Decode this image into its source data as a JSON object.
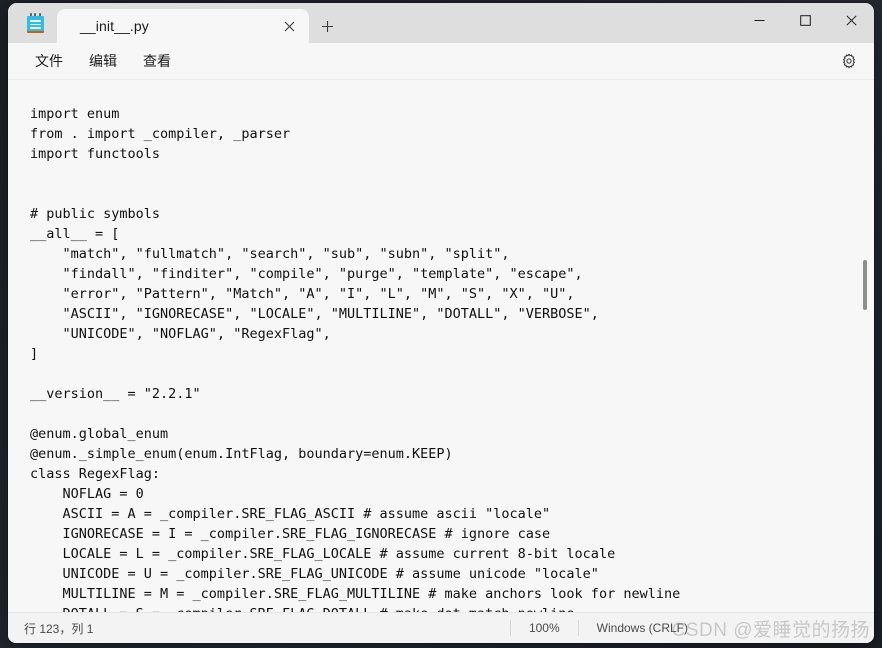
{
  "window": {
    "app_icon": "notepad-icon",
    "minimize_label": "最小化",
    "maximize_label": "最大化",
    "close_label": "关闭"
  },
  "tabs": [
    {
      "title": "__init__.py",
      "close_label": "×"
    }
  ],
  "new_tab_label": "+",
  "menubar": {
    "items": [
      {
        "label": "文件"
      },
      {
        "label": "编辑"
      },
      {
        "label": "查看"
      }
    ],
    "settings_label": "设置"
  },
  "editor": {
    "content": "import enum\nfrom . import _compiler, _parser\nimport functools\n\n\n# public symbols\n__all__ = [\n    \"match\", \"fullmatch\", \"search\", \"sub\", \"subn\", \"split\",\n    \"findall\", \"finditer\", \"compile\", \"purge\", \"template\", \"escape\",\n    \"error\", \"Pattern\", \"Match\", \"A\", \"I\", \"L\", \"M\", \"S\", \"X\", \"U\",\n    \"ASCII\", \"IGNORECASE\", \"LOCALE\", \"MULTILINE\", \"DOTALL\", \"VERBOSE\",\n    \"UNICODE\", \"NOFLAG\", \"RegexFlag\",\n]\n\n__version__ = \"2.2.1\"\n\n@enum.global_enum\n@enum._simple_enum(enum.IntFlag, boundary=enum.KEEP)\nclass RegexFlag:\n    NOFLAG = 0\n    ASCII = A = _compiler.SRE_FLAG_ASCII # assume ascii \"locale\"\n    IGNORECASE = I = _compiler.SRE_FLAG_IGNORECASE # ignore case\n    LOCALE = L = _compiler.SRE_FLAG_LOCALE # assume current 8-bit locale\n    UNICODE = U = _compiler.SRE_FLAG_UNICODE # assume unicode \"locale\"\n    MULTILINE = M = _compiler.SRE_FLAG_MULTILINE # make anchors look for newline\n    DOTALL = S = _compiler.SRE_FLAG_DOTALL # make dot match newline"
  },
  "statusbar": {
    "position": "行 123，列 1",
    "zoom": "100%",
    "line_ending": "Windows (CRLF)"
  },
  "watermark": {
    "text": "CSDN @爱睡觉的扬扬"
  },
  "colors": {
    "accent": "#32bde8",
    "titlebar_bg": "#dedede",
    "surface": "#f7f7f7",
    "statusbar_bg": "#f3f3f3",
    "text": "#101010",
    "close_hover": "#e81123"
  }
}
